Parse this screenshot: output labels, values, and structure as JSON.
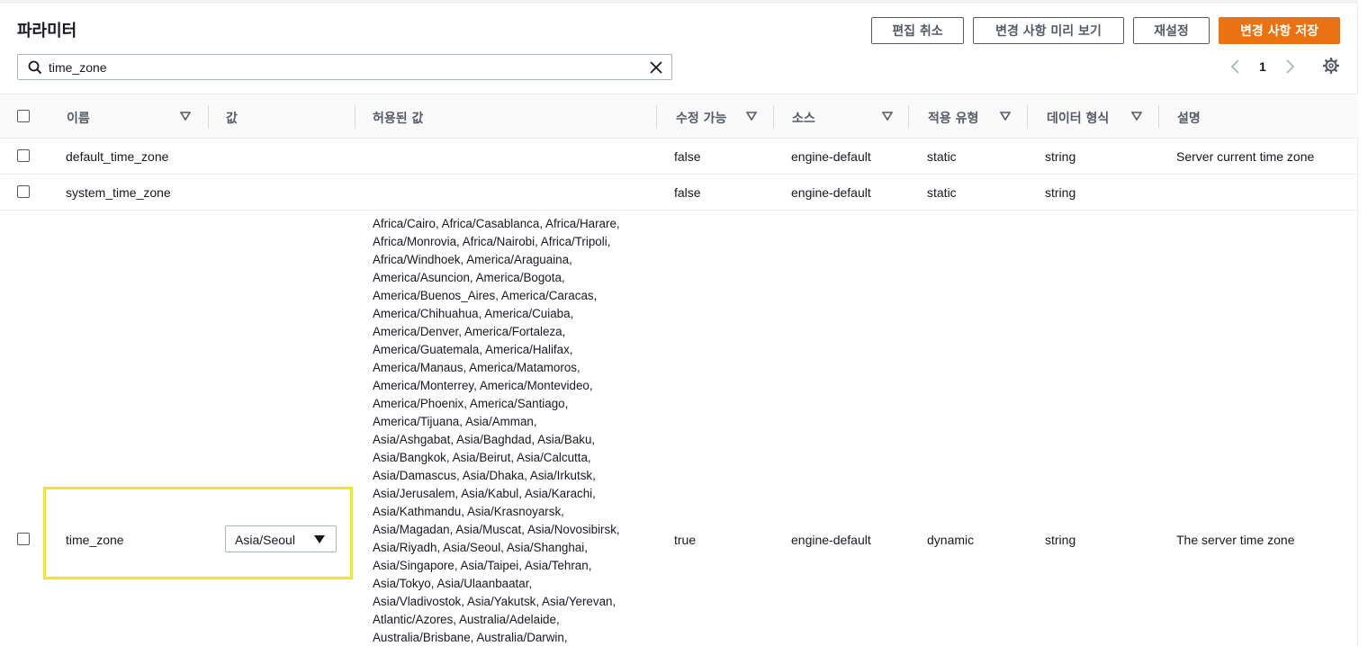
{
  "header": {
    "title": "파라미터",
    "buttons": {
      "cancel": "편집 취소",
      "preview": "변경 사항 미리 보기",
      "reset": "재설정",
      "save": "변경 사항 저장"
    }
  },
  "search": {
    "value": "time_zone"
  },
  "pagination": {
    "current_page": "1"
  },
  "columns": {
    "name": "이름",
    "value": "값",
    "allowed": "허용된 값",
    "modifiable": "수정 가능",
    "source": "소스",
    "apply_type": "적용 유형",
    "data_type": "데이터 형식",
    "description": "설명"
  },
  "rows": [
    {
      "name": "default_time_zone",
      "modifiable": "false",
      "source": "engine-default",
      "apply_type": "static",
      "data_type": "string",
      "description": "Server current time zone"
    },
    {
      "name": "system_time_zone",
      "modifiable": "false",
      "source": "engine-default",
      "apply_type": "static",
      "data_type": "string",
      "description": ""
    },
    {
      "name": "time_zone",
      "value": "Asia/Seoul",
      "modifiable": "true",
      "source": "engine-default",
      "apply_type": "dynamic",
      "data_type": "string",
      "description": "The server time zone",
      "allowed_lines": [
        "Africa/Cairo, Africa/Casablanca, Africa/Harare,",
        "Africa/Monrovia, Africa/Nairobi, Africa/Tripoli,",
        "Africa/Windhoek, America/Araguaina,",
        "America/Asuncion, America/Bogota,",
        "America/Buenos_Aires, America/Caracas,",
        "America/Chihuahua, America/Cuiaba,",
        "America/Denver, America/Fortaleza,",
        "America/Guatemala, America/Halifax,",
        "America/Manaus, America/Matamoros,",
        "America/Monterrey, America/Montevideo,",
        "America/Phoenix, America/Santiago,",
        "America/Tijuana, Asia/Amman,",
        "Asia/Ashgabat, Asia/Baghdad, Asia/Baku,",
        "Asia/Bangkok, Asia/Beirut, Asia/Calcutta,",
        "Asia/Damascus, Asia/Dhaka, Asia/Irkutsk,",
        "Asia/Jerusalem, Asia/Kabul, Asia/Karachi,",
        "Asia/Kathmandu, Asia/Krasnoyarsk,",
        "Asia/Magadan, Asia/Muscat, Asia/Novosibirsk,",
        "Asia/Riyadh, Asia/Seoul, Asia/Shanghai,",
        "Asia/Singapore, Asia/Taipei, Asia/Tehran,",
        "Asia/Tokyo, Asia/Ulaanbaatar,",
        "Asia/Vladivostok, Asia/Yakutsk, Asia/Yerevan,",
        "Atlantic/Azores, Australia/Adelaide,",
        "Australia/Brisbane, Australia/Darwin,"
      ]
    }
  ],
  "colors": {
    "primary_button": "#ec7211",
    "highlight_box": "#f0e81a",
    "text": "#16191f",
    "muted": "#545b64"
  }
}
